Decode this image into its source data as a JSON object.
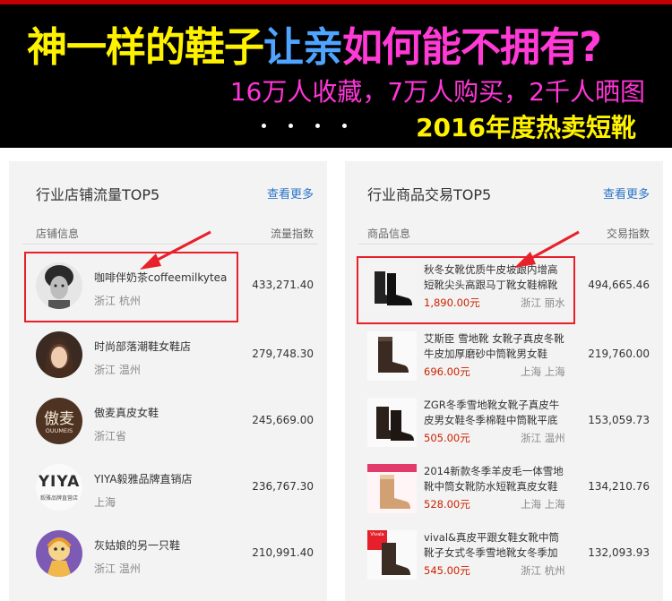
{
  "banner": {
    "headline_parts": [
      {
        "text": "神一样的鞋子",
        "color": "#fff200"
      },
      {
        "text": "让亲",
        "color": "#4fa4ff"
      },
      {
        "text": "如何能不拥有?",
        "color": "#ff3ad6"
      }
    ],
    "subline": "16万人收藏，7万人购买，2千人晒图",
    "tagline": "2016年度热卖短靴"
  },
  "stores": {
    "title": "行业店铺流量TOP5",
    "more": "查看更多",
    "col_info": "店铺信息",
    "col_index": "流量指数",
    "items": [
      {
        "name": "咖啡伴奶茶coffeemilkytea",
        "location": "浙江 杭州",
        "value": "433,271.40",
        "avatar": "portrait-icon"
      },
      {
        "name": "时尚部落潮鞋女鞋店",
        "location": "浙江 温州",
        "value": "279,748.30",
        "avatar": "portrait-icon"
      },
      {
        "name": "傲麦真皮女鞋",
        "location": "浙江省",
        "value": "245,669.00",
        "avatar": "brand-logo-icon",
        "logo_text": "傲麦",
        "logo_sub": "OUUMEIS"
      },
      {
        "name": "YIYA毅雅品牌直销店",
        "location": "上海",
        "value": "236,767.30",
        "avatar": "brand-logo-icon",
        "logo_text": "YIYA",
        "logo_sub": "毅雅品牌直营店"
      },
      {
        "name": "灰姑娘的另一只鞋",
        "location": "浙江 温州",
        "value": "210,991.40",
        "avatar": "cartoon-icon"
      }
    ]
  },
  "products": {
    "title": "行业商品交易TOP5",
    "more": "查看更多",
    "col_info": "商品信息",
    "col_index": "交易指数",
    "items": [
      {
        "name": "秋冬女靴优质牛皮坡跟内增高短靴尖头高跟马丁靴女鞋棉靴",
        "price": "1,890.00元",
        "location": "浙江 丽水",
        "value": "494,665.46",
        "image": "black-boot-icon"
      },
      {
        "name": "艾斯臣 雪地靴 女靴子真皮冬靴牛皮加厚磨砂中筒靴男女鞋",
        "price": "696.00元",
        "location": "上海 上海",
        "value": "219,760.00",
        "image": "snow-boot-icon"
      },
      {
        "name": "ZGR冬季雪地靴女靴子真皮牛皮男女鞋冬季棉鞋中筒靴平底",
        "price": "505.00元",
        "location": "浙江 温州",
        "value": "153,059.73",
        "image": "snow-boot-icon"
      },
      {
        "name": "2014新款冬季羊皮毛一体雪地靴中筒女靴防水短靴真皮女鞋",
        "price": "528.00元",
        "location": "上海 上海",
        "value": "134,210.76",
        "image": "tan-boot-icon"
      },
      {
        "name": "vival&真皮平跟女鞋女靴中筒靴子女式冬季雪地靴女冬季加",
        "price": "545.00元",
        "location": "浙江 杭州",
        "value": "132,093.93",
        "image": "snow-boot-icon",
        "badge": "Vivala"
      }
    ]
  }
}
